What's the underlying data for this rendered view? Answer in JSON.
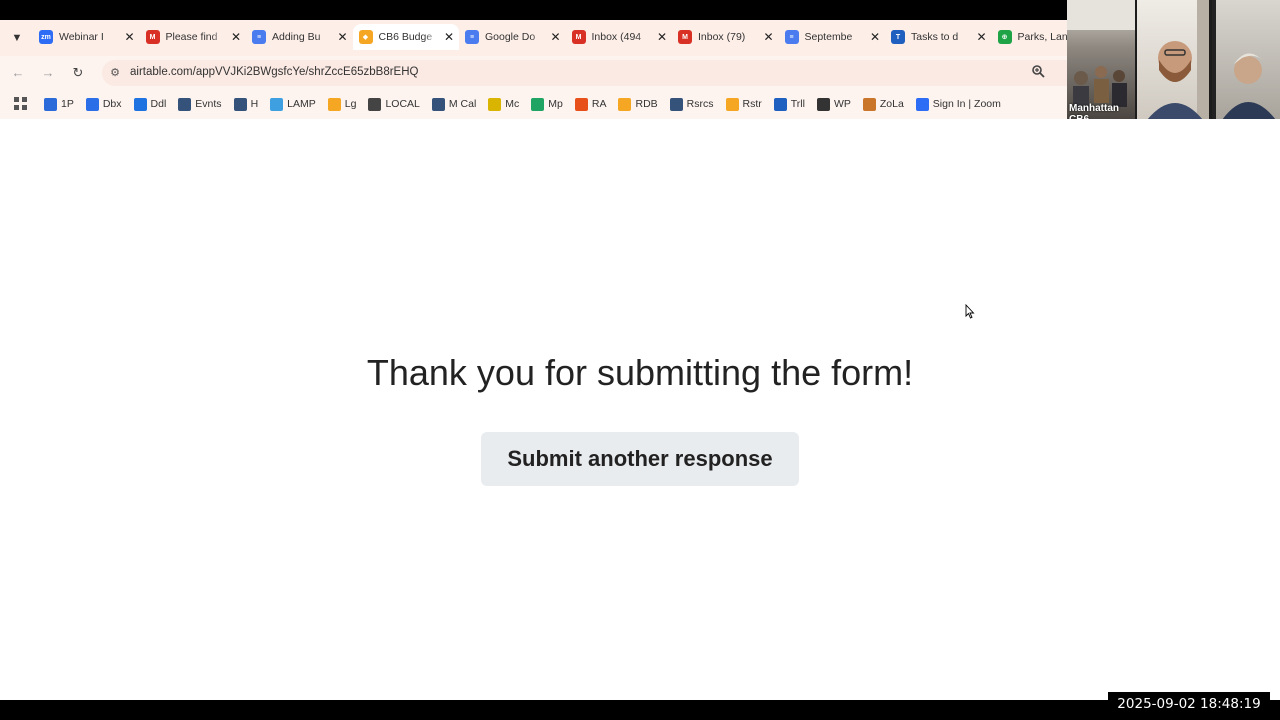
{
  "browser": {
    "tabs": [
      {
        "title": "Webinar I",
        "icon": "zoom-icon",
        "color": "#2d6cf5",
        "glyph": "zm"
      },
      {
        "title": "Please find",
        "icon": "gmail-icon",
        "color": "#d93025",
        "glyph": "M"
      },
      {
        "title": "Adding Bu",
        "icon": "google-docs-icon",
        "color": "#4a7cf0",
        "glyph": "≡"
      },
      {
        "title": "CB6 Budge",
        "icon": "airtable-icon",
        "color": "#f5a623",
        "glyph": "◆"
      },
      {
        "title": "Google Do",
        "icon": "google-docs-icon",
        "color": "#4a7cf0",
        "glyph": "≡"
      },
      {
        "title": "Inbox (494",
        "icon": "gmail-icon",
        "color": "#d93025",
        "glyph": "M"
      },
      {
        "title": "Inbox (79)",
        "icon": "gmail-icon",
        "color": "#d93025",
        "glyph": "M"
      },
      {
        "title": "Septembe",
        "icon": "google-docs-icon",
        "color": "#4a7cf0",
        "glyph": "≡"
      },
      {
        "title": "Tasks to d",
        "icon": "trello-icon",
        "color": "#1f5fbf",
        "glyph": "T"
      },
      {
        "title": "Parks, Lan",
        "icon": "sheet-icon",
        "color": "#1ea446",
        "glyph": "⊕"
      }
    ],
    "active_tab": 3,
    "url": "airtable.com/appVVJKi2BWgsfcYe/shrZccE65zbB8rEHQ"
  },
  "bookmarks": [
    {
      "label": "1P",
      "icon": "1password-icon",
      "color": "#2b6bd9"
    },
    {
      "label": "Dbx",
      "icon": "dropbox-icon",
      "color": "#2a6ee8"
    },
    {
      "label": "Ddl",
      "icon": "ddl-icon",
      "color": "#1e73e0"
    },
    {
      "label": "Evnts",
      "icon": "cb6-icon",
      "color": "#34527a"
    },
    {
      "label": "H",
      "icon": "cb6-icon",
      "color": "#34527a"
    },
    {
      "label": "LAMP",
      "icon": "lamp-icon",
      "color": "#3ea0e0"
    },
    {
      "label": "Lg",
      "icon": "airtable-icon",
      "color": "#f5a623"
    },
    {
      "label": "LOCAL",
      "icon": "globe-icon",
      "color": "#444444"
    },
    {
      "label": "M Cal",
      "icon": "cb6-icon",
      "color": "#34527a"
    },
    {
      "label": "Mc",
      "icon": "mailchimp-icon",
      "color": "#d9b400"
    },
    {
      "label": "Mp",
      "icon": "google-drive-icon",
      "color": "#1fa463"
    },
    {
      "label": "RA",
      "icon": "ra-icon",
      "color": "#e8501a"
    },
    {
      "label": "RDB",
      "icon": "airtable-icon",
      "color": "#f5a623"
    },
    {
      "label": "Rsrcs",
      "icon": "cb6-icon",
      "color": "#34527a"
    },
    {
      "label": "Rstr",
      "icon": "airtable-icon",
      "color": "#f5a623"
    },
    {
      "label": "Trll",
      "icon": "trello-icon",
      "color": "#1f5fbf"
    },
    {
      "label": "WP",
      "icon": "wordpress-icon",
      "color": "#333333"
    },
    {
      "label": "ZoLa",
      "icon": "zola-icon",
      "color": "#c9762b"
    },
    {
      "label": "Sign In | Zoom",
      "icon": "zoom-icon",
      "color": "#2d6cf5"
    }
  ],
  "video": {
    "participant_name": "Manhattan CB6"
  },
  "page": {
    "heading": "Thank you for submitting the form!",
    "button_label": "Submit another response"
  },
  "recording": {
    "timestamp": "2025-09-02  18:48:19"
  }
}
